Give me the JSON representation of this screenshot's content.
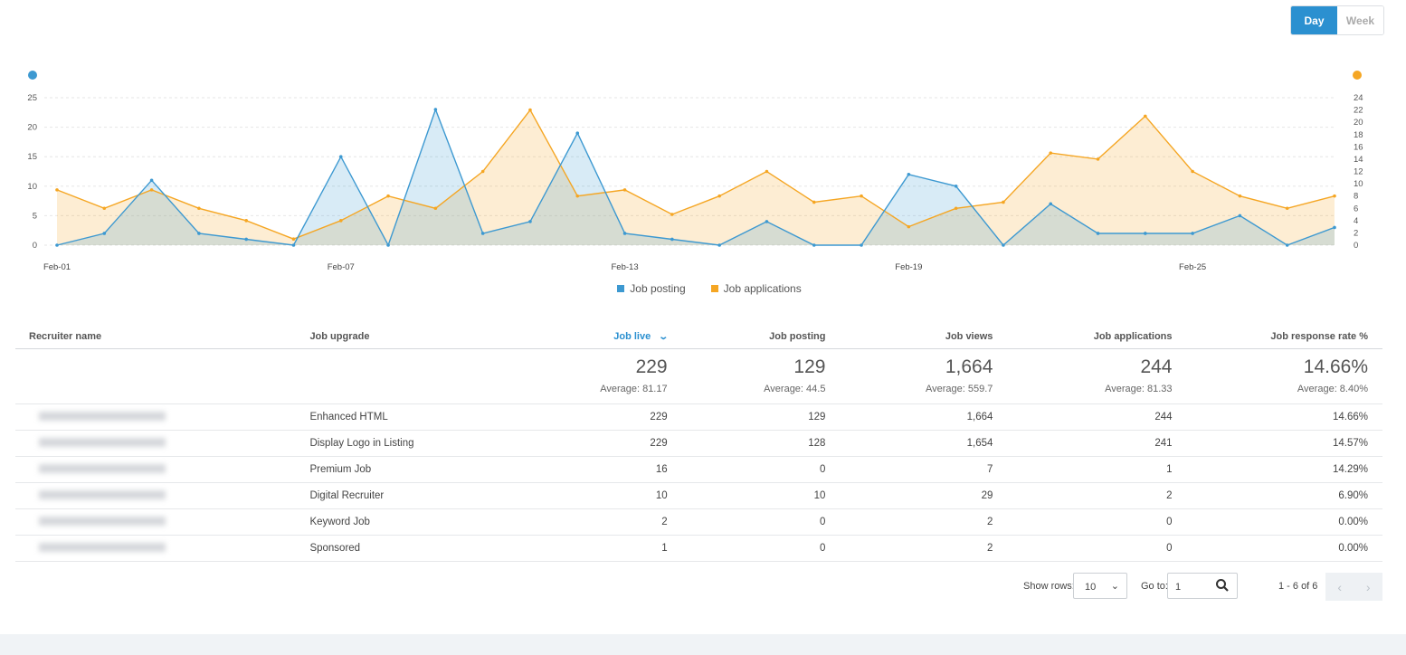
{
  "toggle": {
    "day": "Day",
    "week": "Week",
    "active": "Day"
  },
  "colors": {
    "posting": "#3d99d1",
    "applications": "#f5a623",
    "accent": "#2b90d0"
  },
  "chart_data": {
    "type": "area",
    "x": [
      "Feb-01",
      "Feb-02",
      "Feb-03",
      "Feb-04",
      "Feb-05",
      "Feb-06",
      "Feb-07",
      "Feb-08",
      "Feb-09",
      "Feb-10",
      "Feb-11",
      "Feb-12",
      "Feb-13",
      "Feb-14",
      "Feb-15",
      "Feb-16",
      "Feb-17",
      "Feb-18",
      "Feb-19",
      "Feb-20",
      "Feb-21",
      "Feb-22",
      "Feb-23",
      "Feb-24",
      "Feb-25",
      "Feb-26",
      "Feb-27",
      "Feb-28"
    ],
    "xticks": [
      "Feb-01",
      "Feb-07",
      "Feb-13",
      "Feb-19",
      "Feb-25"
    ],
    "series": [
      {
        "name": "Job posting",
        "axis": "left",
        "values": [
          0,
          2,
          11,
          2,
          1,
          0,
          15,
          0,
          23,
          2,
          4,
          19,
          2,
          1,
          0,
          4,
          0,
          0,
          12,
          10,
          0,
          7,
          2,
          2,
          2,
          5,
          0,
          3
        ]
      },
      {
        "name": "Job applications",
        "axis": "right",
        "values": [
          9,
          6,
          9,
          6,
          4,
          1,
          4,
          8,
          6,
          12,
          22,
          8,
          9,
          5,
          8,
          12,
          7,
          8,
          3,
          6,
          7,
          15,
          14,
          21,
          12,
          8,
          6,
          8
        ]
      }
    ],
    "ylim_left": [
      0,
      25
    ],
    "yticks_left": [
      0,
      5,
      10,
      15,
      20,
      25
    ],
    "ylim_right": [
      0,
      24
    ],
    "yticks_right": [
      0,
      2,
      4,
      6,
      8,
      10,
      12,
      14,
      16,
      18,
      20,
      22,
      24
    ],
    "grid": true,
    "legend_placement": "bottom"
  },
  "table": {
    "headers": {
      "recruiter": "Recruiter name",
      "upgrade": "Job upgrade",
      "live": "Job live",
      "posting": "Job posting",
      "views": "Job views",
      "applications": "Job applications",
      "response": "Job response rate %"
    },
    "totals": {
      "live": "229",
      "live_avg": "Average: 81.17",
      "posting": "129",
      "posting_avg": "Average: 44.5",
      "views": "1,664",
      "views_avg": "Average: 559.7",
      "applications": "244",
      "applications_avg": "Average: 81.33",
      "response": "14.66%",
      "response_avg": "Average: 8.40%"
    },
    "rows": [
      {
        "upgrade": "Enhanced HTML",
        "live": "229",
        "posting": "129",
        "views": "1,664",
        "applications": "244",
        "response": "14.66%"
      },
      {
        "upgrade": "Display Logo in Listing",
        "live": "229",
        "posting": "128",
        "views": "1,654",
        "applications": "241",
        "response": "14.57%"
      },
      {
        "upgrade": "Premium Job",
        "live": "16",
        "posting": "0",
        "views": "7",
        "applications": "1",
        "response": "14.29%"
      },
      {
        "upgrade": "Digital Recruiter",
        "live": "10",
        "posting": "10",
        "views": "29",
        "applications": "2",
        "response": "6.90%"
      },
      {
        "upgrade": "Keyword Job",
        "live": "2",
        "posting": "0",
        "views": "2",
        "applications": "0",
        "response": "0.00%"
      },
      {
        "upgrade": "Sponsored",
        "live": "1",
        "posting": "0",
        "views": "2",
        "applications": "0",
        "response": "0.00%"
      }
    ]
  },
  "pager": {
    "show_rows_label": "Show rows:",
    "rows_value": "10",
    "goto_label": "Go to:",
    "goto_value": "1",
    "range": "1 - 6 of 6"
  }
}
